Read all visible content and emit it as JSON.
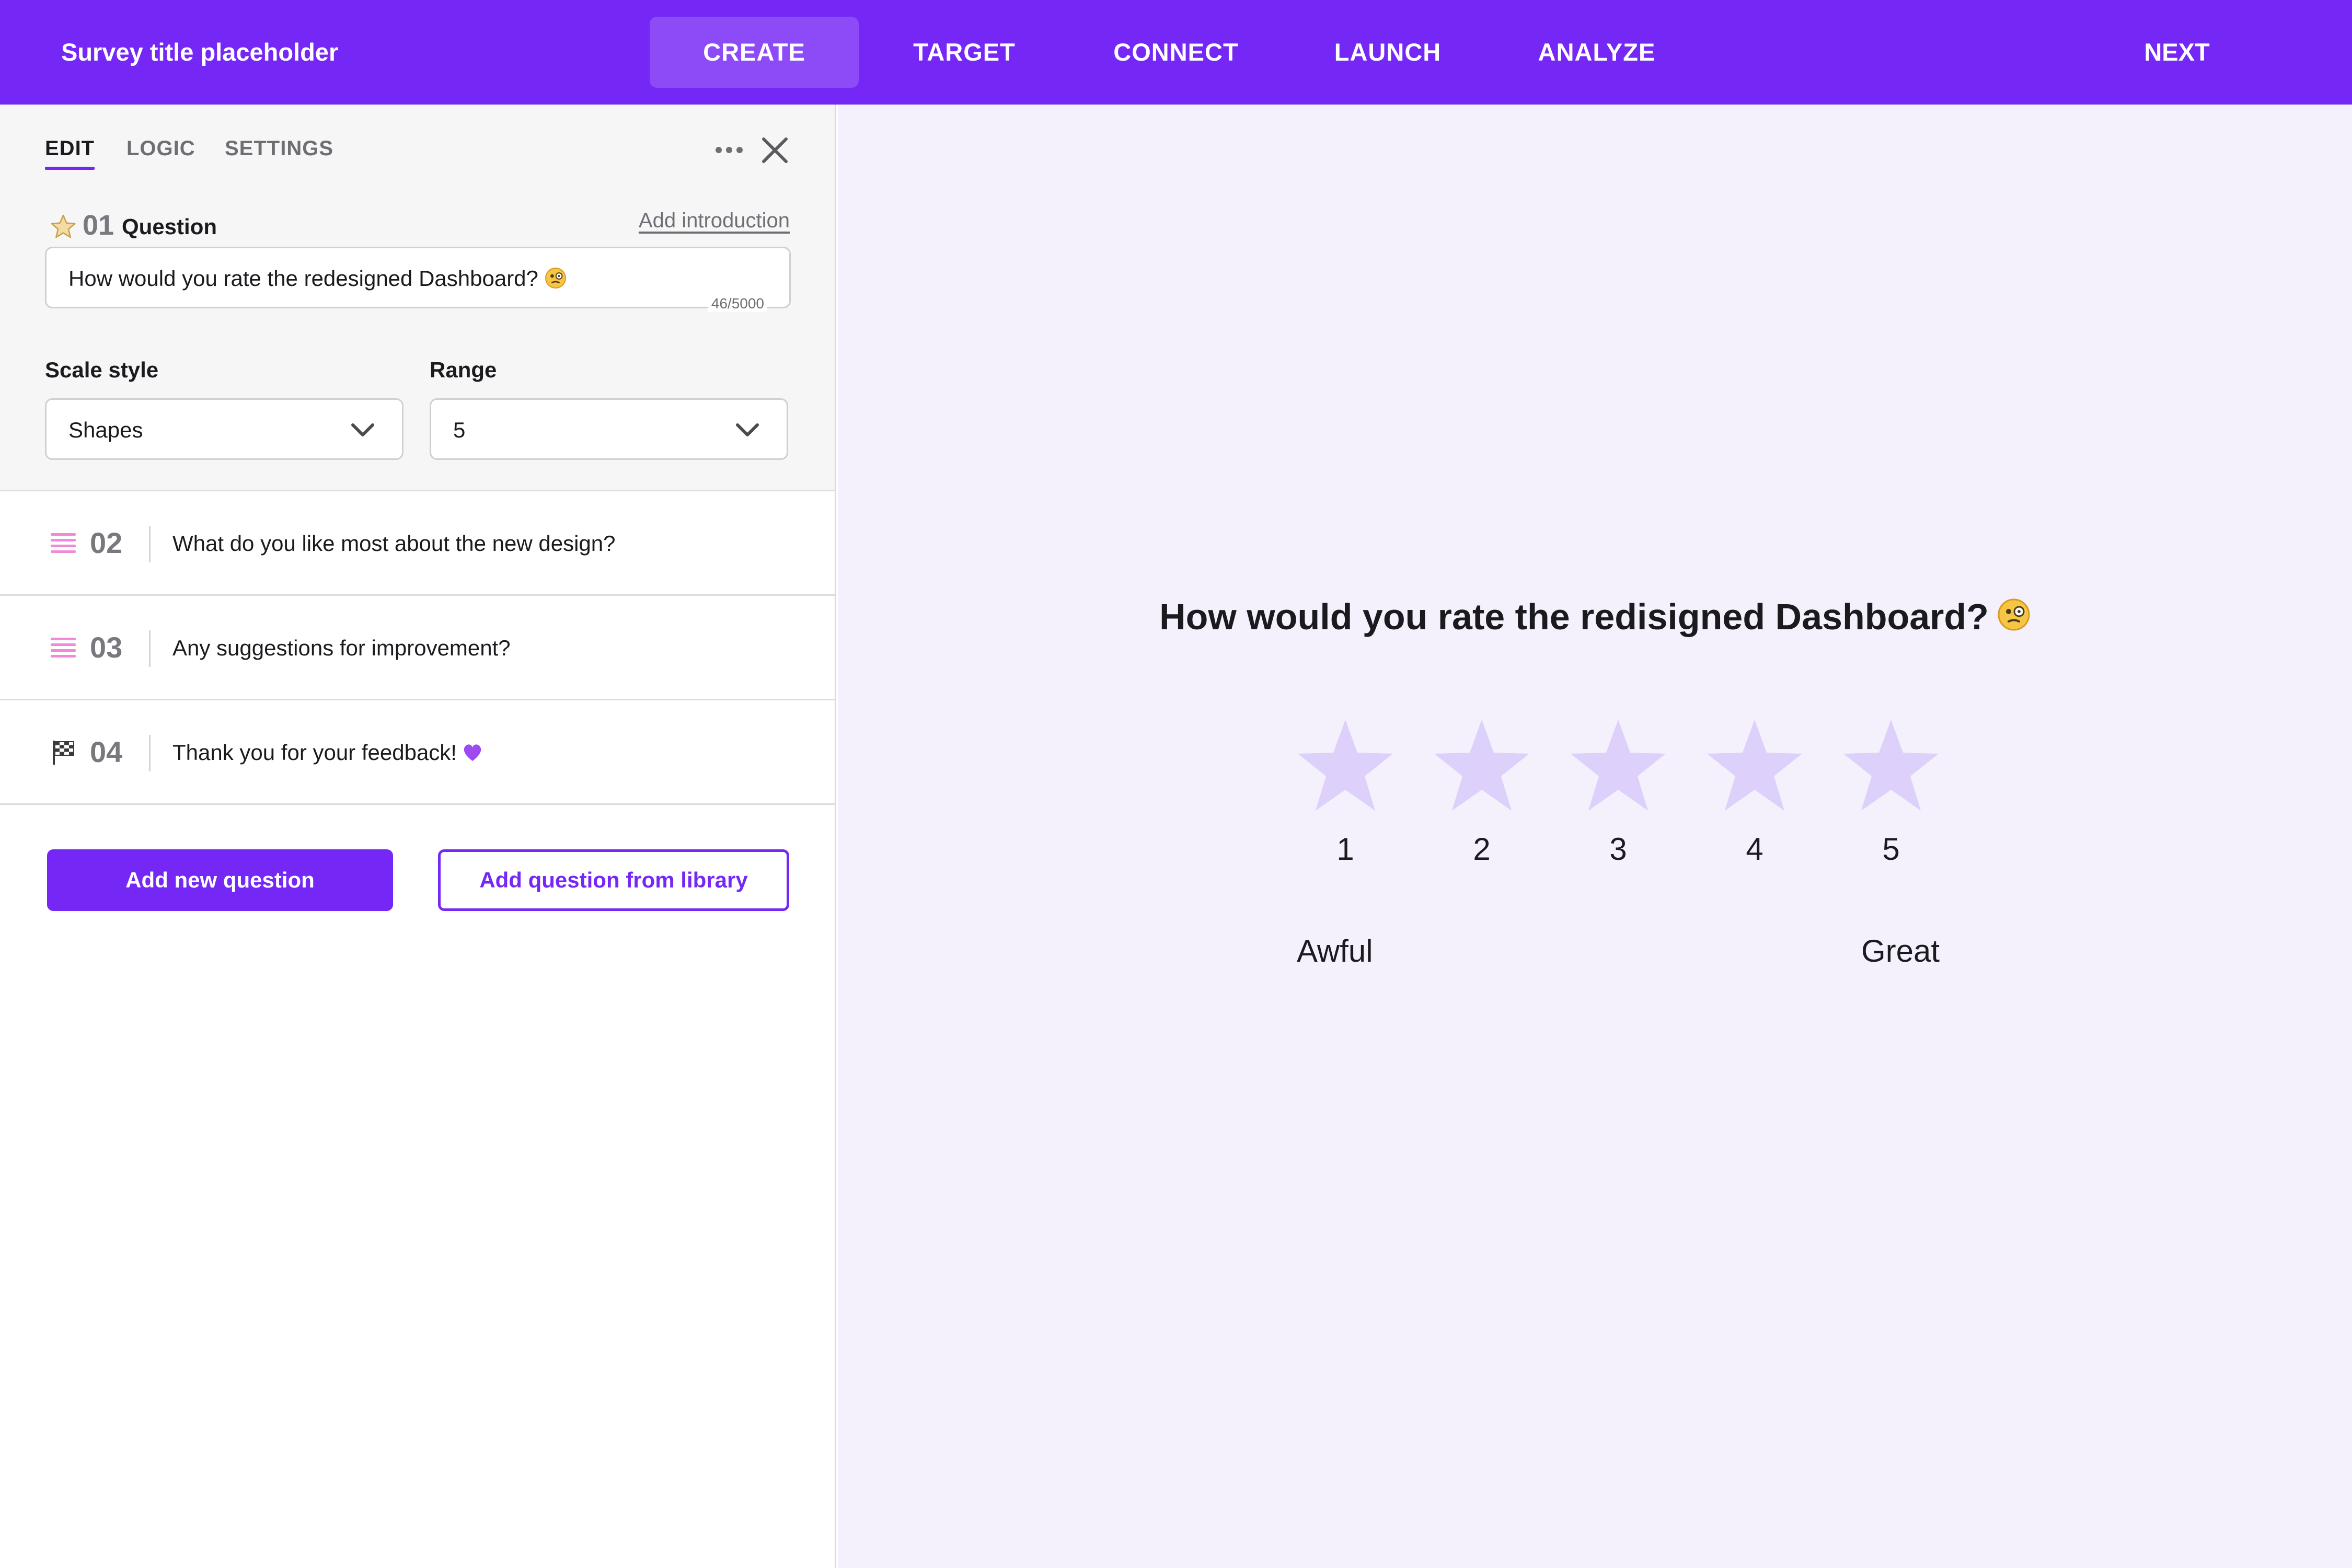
{
  "header": {
    "survey_title": "Survey title placeholder",
    "tabs": [
      {
        "label": "CREATE",
        "active": true
      },
      {
        "label": "TARGET",
        "active": false
      },
      {
        "label": "CONNECT",
        "active": false
      },
      {
        "label": "LAUNCH",
        "active": false
      },
      {
        "label": "ANALYZE",
        "active": false
      }
    ],
    "next_label": "NEXT"
  },
  "editor": {
    "tabs": [
      {
        "label": "EDIT",
        "active": true
      },
      {
        "label": "LOGIC",
        "active": false
      },
      {
        "label": "SETTINGS",
        "active": false
      }
    ],
    "question_number": "01",
    "question_label": "Question",
    "add_introduction": "Add introduction",
    "question_text": "How would you rate the redesigned Dashboard?",
    "char_counter": "46/5000",
    "scale_style_label": "Scale style",
    "scale_style_value": "Shapes",
    "range_label": "Range",
    "range_value": "5"
  },
  "questions": [
    {
      "number": "02",
      "text": "What do you like most about the new design?",
      "icon": "text-lines-icon"
    },
    {
      "number": "03",
      "text": "Any suggestions for improvement?",
      "icon": "text-lines-icon"
    },
    {
      "number": "04",
      "text": "Thank you for your feedback!",
      "icon": "checkered-flag-icon"
    }
  ],
  "actions": {
    "add_new_question": "Add new question",
    "add_from_library": "Add question from library"
  },
  "preview": {
    "question": "How would you rate the redisigned Dashboard?",
    "ratings": [
      "1",
      "2",
      "3",
      "4",
      "5"
    ],
    "low_label": "Awful",
    "high_label": "Great"
  },
  "colors": {
    "brand": "#7528f5",
    "active_tab_bg": "#8d4bf7",
    "star_fill": "#ddd0fb",
    "preview_bg": "#f4f1fc",
    "question_icon": "#f08ad6"
  }
}
